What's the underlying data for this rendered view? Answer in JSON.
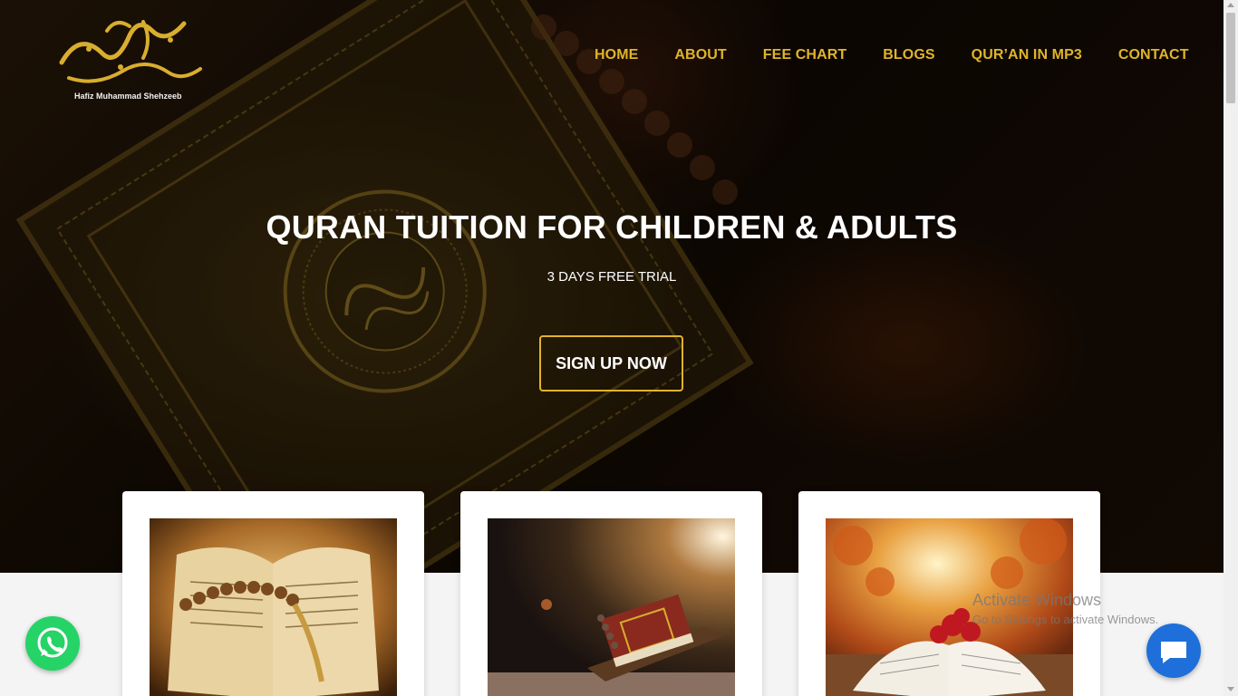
{
  "logo": {
    "caption": "Hafiz Muhammad Shehzeeb"
  },
  "nav": {
    "items": [
      "HOME",
      "ABOUT",
      "FEE CHART",
      "BLOGS",
      "QUR’AN IN MP3",
      "CONTACT"
    ]
  },
  "hero": {
    "title": "QURAN TUITION FOR CHILDREN & ADULTS",
    "subtitle": "3 DAYS FREE TRIAL",
    "cta_label": "SIGN UP NOW"
  },
  "cards": [
    {
      "image": "open-quran-with-prayer-beads"
    },
    {
      "image": "quran-on-wooden-stand"
    },
    {
      "image": "open-quran-with-red-roses"
    }
  ],
  "widgets": {
    "whatsapp_icon": "whatsapp-icon",
    "chat_icon": "chat-bubble-icon"
  },
  "watermark": {
    "line1": "Activate Windows",
    "line2": "Go to Settings to activate Windows."
  },
  "colors": {
    "accent_gold": "#e0b42a",
    "whatsapp_green": "#25d366",
    "chat_blue": "#1e6fd9"
  }
}
